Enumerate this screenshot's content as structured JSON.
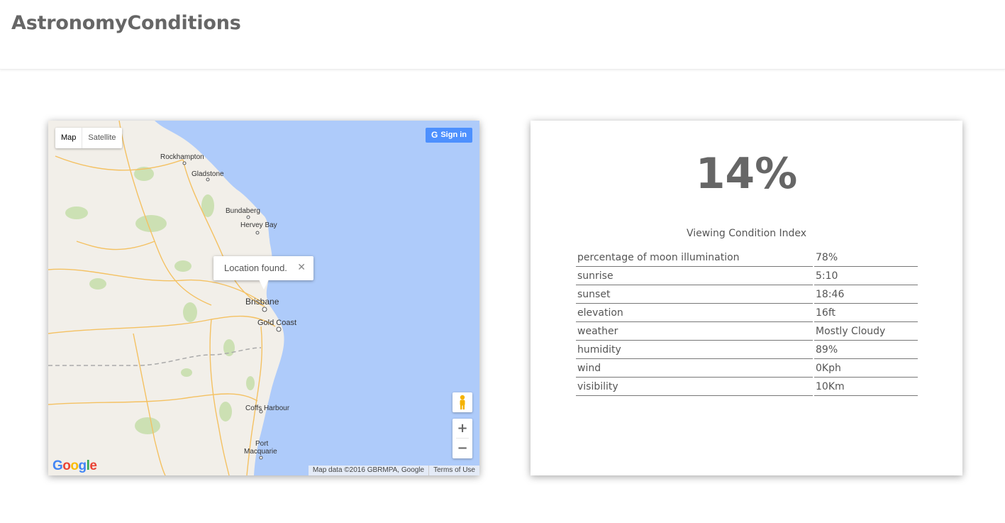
{
  "app": {
    "title": "AstronomyConditions"
  },
  "map": {
    "type_controls": {
      "map_label": "Map",
      "satellite_label": "Satellite"
    },
    "signin_label": "Sign in",
    "info_window": {
      "text": "Location found.",
      "close_glyph": "✕"
    },
    "places": {
      "rockhampton": "Rockhampton",
      "gladstone": "Gladstone",
      "bundaberg": "Bundaberg",
      "hervey_bay": "Hervey Bay",
      "brisbane": "Brisbane",
      "gold_coast": "Gold Coast",
      "coffs_harbour": "Coffs Harbour",
      "port_macquarie_1": "Port",
      "port_macquarie_2": "Macquarie"
    },
    "zoom_in_label": "+",
    "zoom_out_label": "−",
    "logo": "Google",
    "attribution": "Map data ©2016 GBRMPA, Google",
    "terms": "Terms of Use",
    "colors": {
      "water": "#aecbfa",
      "land": "#f2efe9",
      "park": "#c8dfae",
      "road": "#f4c162"
    }
  },
  "conditions": {
    "index_value": "14%",
    "index_label": "Viewing Condition Index",
    "rows": [
      {
        "label": "percentage of moon illumination",
        "value": "78%"
      },
      {
        "label": "sunrise",
        "value": "5:10"
      },
      {
        "label": "sunset",
        "value": "18:46"
      },
      {
        "label": "elevation",
        "value": "16ft"
      },
      {
        "label": "weather",
        "value": "Mostly Cloudy"
      },
      {
        "label": "humidity",
        "value": "89%"
      },
      {
        "label": "wind",
        "value": "0Kph"
      },
      {
        "label": "visibility",
        "value": "10Km"
      }
    ]
  }
}
